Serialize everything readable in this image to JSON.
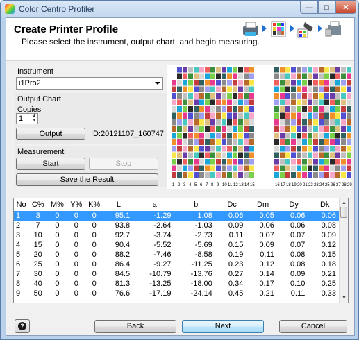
{
  "window": {
    "title": "Color Centro Profiler"
  },
  "header": {
    "title": "Create Printer Profile",
    "subtitle": "Please select the instrument, output chart, and begin measuring."
  },
  "instrument": {
    "label": "Instrument",
    "selected": "i1Pro2"
  },
  "output_chart": {
    "label": "Output Chart",
    "copies_label": "Copies",
    "copies_value": "1",
    "output_button": "Output",
    "id_text": "ID:20121107_160747"
  },
  "measurement": {
    "label": "Measurement",
    "start_button": "Start",
    "stop_button": "Stop",
    "save_button": "Save the Result"
  },
  "chart_columns": [
    "1",
    "2",
    "3",
    "4",
    "5",
    "6",
    "7",
    "8",
    "9",
    "10",
    "11",
    "12",
    "13",
    "14",
    "15",
    "16",
    "17",
    "18",
    "19",
    "20",
    "21",
    "22",
    "23",
    "24",
    "25",
    "26",
    "27",
    "28",
    "29"
  ],
  "table": {
    "headers": [
      "No",
      "C%",
      "M%",
      "Y%",
      "K%",
      "L",
      "a",
      "b",
      "Dc",
      "Dm",
      "Dy",
      "Dk"
    ],
    "rows": [
      [
        "1",
        "3",
        "0",
        "0",
        "0",
        "95.1",
        "-1.29",
        "1.08",
        "0.06",
        "0.05",
        "0.06",
        "0.06"
      ],
      [
        "2",
        "7",
        "0",
        "0",
        "0",
        "93.8",
        "-2.64",
        "-1.03",
        "0.09",
        "0.06",
        "0.06",
        "0.08"
      ],
      [
        "3",
        "10",
        "0",
        "0",
        "0",
        "92.7",
        "-3.74",
        "-2.73",
        "0.11",
        "0.07",
        "0.07",
        "0.09"
      ],
      [
        "4",
        "15",
        "0",
        "0",
        "0",
        "90.4",
        "-5.52",
        "-5.69",
        "0.15",
        "0.09",
        "0.07",
        "0.12"
      ],
      [
        "5",
        "20",
        "0",
        "0",
        "0",
        "88.2",
        "-7.46",
        "-8.58",
        "0.19",
        "0.11",
        "0.08",
        "0.15"
      ],
      [
        "6",
        "25",
        "0",
        "0",
        "0",
        "86.4",
        "-9.27",
        "-11.25",
        "0.23",
        "0.12",
        "0.08",
        "0.18"
      ],
      [
        "7",
        "30",
        "0",
        "0",
        "0",
        "84.5",
        "-10.79",
        "-13.76",
        "0.27",
        "0.14",
        "0.09",
        "0.21"
      ],
      [
        "8",
        "40",
        "0",
        "0",
        "0",
        "81.3",
        "-13.25",
        "-18.00",
        "0.34",
        "0.17",
        "0.10",
        "0.25"
      ],
      [
        "9",
        "50",
        "0",
        "0",
        "0",
        "76.6",
        "-17.19",
        "-24.14",
        "0.45",
        "0.21",
        "0.11",
        "0.33"
      ]
    ],
    "selected_row": 0
  },
  "footer": {
    "help_icon": "help-icon",
    "back_button": "Back",
    "next_button": "Next",
    "cancel_button": "Cancel"
  }
}
